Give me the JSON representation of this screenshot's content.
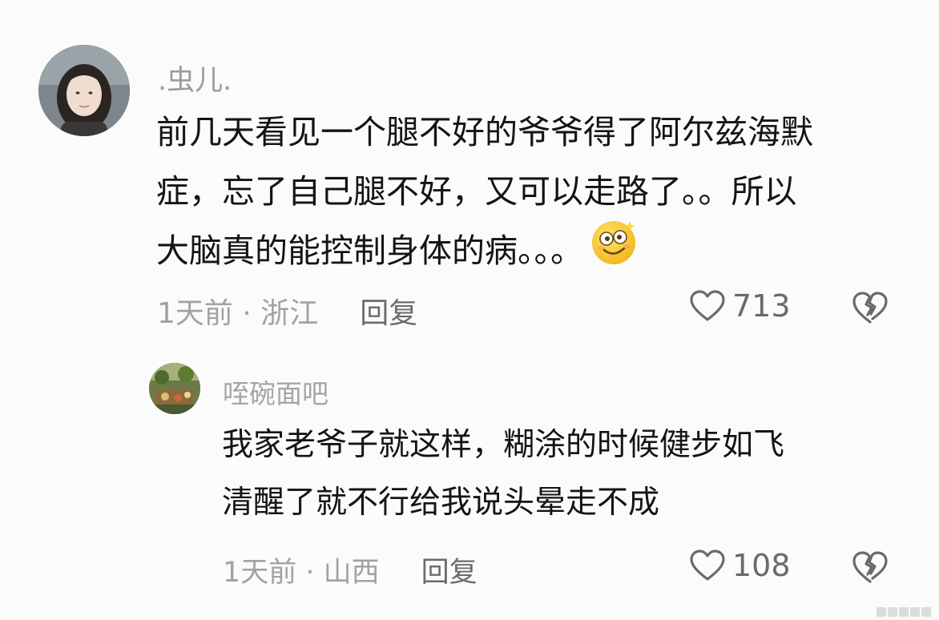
{
  "comments": [
    {
      "username": ".虫儿.",
      "lines": [
        "前几天看见一个腿不好的爷爷得了阿尔兹海默",
        "症，忘了自己腿不好，又可以走路了。。所以",
        "大脑真的能控制身体的病。。。"
      ],
      "emoji": "smiling-face-with-sparkle-emoji",
      "time_location": "1天前 · 浙江",
      "reply_label": "回复",
      "like_count": "713"
    },
    {
      "username": "咥碗面吧",
      "lines": [
        "我家老爷子就这样，糊涂的时候健步如飞",
        "清醒了就不行给我说头晕走不成"
      ],
      "time_location": "1天前 · 山西",
      "reply_label": "回复",
      "like_count": "108"
    }
  ],
  "colors": {
    "background": "#fbfbfb",
    "text_primary": "#141414",
    "text_secondary": "#9c9c9c",
    "reply_link": "#6c6c6c"
  }
}
